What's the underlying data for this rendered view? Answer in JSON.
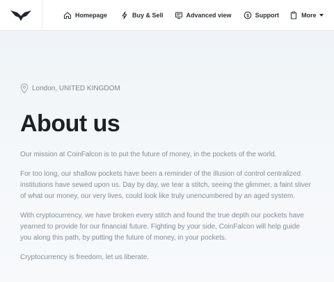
{
  "nav": {
    "items": [
      {
        "label": "Homepage",
        "icon": "home-icon"
      },
      {
        "label": "Buy & Sell",
        "icon": "lightning-icon"
      },
      {
        "label": "Advanced view",
        "icon": "monitor-icon"
      },
      {
        "label": "Support",
        "icon": "dollar-circle-icon"
      },
      {
        "label": "More",
        "icon": "clipboard-icon"
      }
    ]
  },
  "page": {
    "location": "London, UNITED KINGDOM",
    "title": "About us",
    "paragraphs": [
      "Our mission at CoinFalcon is to put the future of money, in the pockets of the world.",
      "For too long, our shallow pockets have been a reminder of the illusion of control centralized institutions have sewed upon us. Day by day, we tear a stitch, seeing the glimmer, a faint sliver of what our money, our very lives, could look like truly unencumbered by an aged system.",
      "With cryptocurrency, we have broken every stitch and found the true depth our pockets have yearned to provide for our financial future. Fighting by your side, CoinFalcon will help guide you along this path, by putting the future of money, in your pockets.",
      "Cryptocurrency is freedom, let us liberate."
    ]
  },
  "colors": {
    "text_dark": "#1b2026",
    "text_muted": "#838d96",
    "background": "#eef3f7"
  }
}
